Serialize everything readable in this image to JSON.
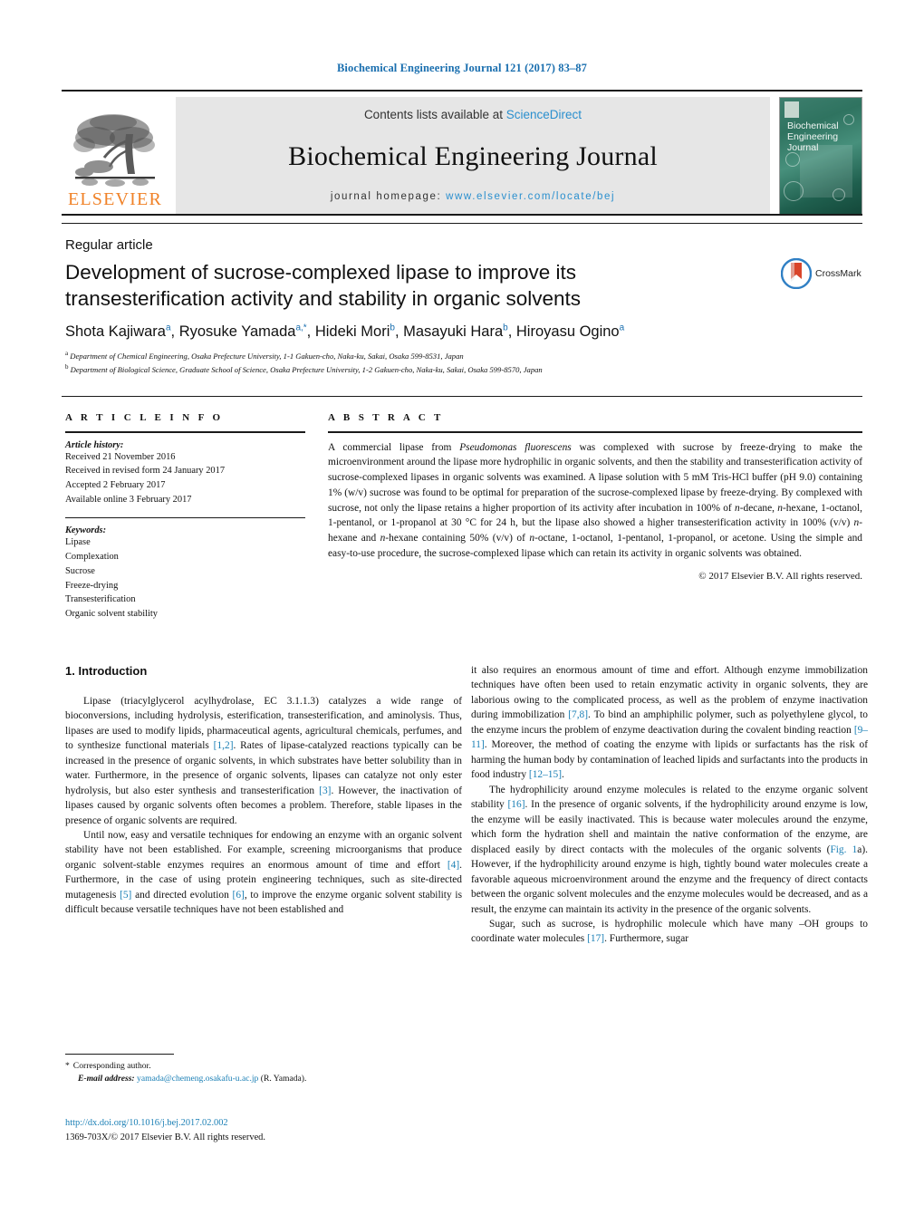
{
  "running_head": "Biochemical Engineering Journal 121 (2017) 83–87",
  "masthead": {
    "contents_prefix": "Contents lists available at ",
    "sciencedirect": "ScienceDirect",
    "journal_name": "Biochemical Engineering Journal",
    "homepage_label": "journal homepage:",
    "homepage_url": "www.elsevier.com/locate/bej",
    "publisher_wordmark": "ELSEVIER",
    "cover_title_line1": "Biochemical",
    "cover_title_line2": "Engineering",
    "cover_title_line3": "Journal",
    "accent_blue": "#2a8fce",
    "elsevier_orange": "#F08228"
  },
  "crossmark": {
    "label": "CrossMark"
  },
  "article": {
    "kicker": "Regular article",
    "title_line1": "Development of sucrose-complexed lipase to improve its",
    "title_line2": "transesterification activity and stability in organic solvents",
    "authors": [
      {
        "name": "Shota Kajiwara",
        "sup": "a",
        "sep": ", "
      },
      {
        "name": "Ryosuke Yamada",
        "sup": "a,",
        "star": "*",
        "sep": ", "
      },
      {
        "name": "Hideki Mori",
        "sup": "b",
        "sep": ", "
      },
      {
        "name": "Masayuki Hara",
        "sup": "b",
        "sep": ", "
      },
      {
        "name": "Hiroyasu Ogino",
        "sup": "a",
        "sep": ""
      }
    ],
    "affiliations": [
      {
        "marker": "a",
        "text": "Department of Chemical Engineering, Osaka Prefecture University, 1-1 Gakuen-cho, Naka-ku, Sakai, Osaka 599-8531, Japan"
      },
      {
        "marker": "b",
        "text": "Department of Biological Science, Graduate School of Science, Osaka Prefecture University, 1-2 Gakuen-cho, Naka-ku, Sakai, Osaka 599-8570, Japan"
      }
    ]
  },
  "article_info": {
    "heading": "A R T I C L E   I N F O",
    "history_label": "Article history:",
    "history": [
      "Received 21 November 2016",
      "Received in revised form 24 January 2017",
      "Accepted 2 February 2017",
      "Available online 3 February 2017"
    ],
    "keywords_label": "Keywords:",
    "keywords": [
      "Lipase",
      "Complexation",
      "Sucrose",
      "Freeze-drying",
      "Transesterification",
      "Organic solvent stability"
    ]
  },
  "abstract": {
    "heading": "A B S T R A C T",
    "text_parts": [
      {
        "t": "A commercial lipase from "
      },
      {
        "t": "Pseudomonas fluorescens",
        "i": true
      },
      {
        "t": " was complexed with sucrose by freeze-drying to make the microenvironment around the lipase more hydrophilic in organic solvents, and then the stability and transesterification activity of sucrose-complexed lipases in organic solvents was examined. A lipase solution with 5 mM Tris-HCl buffer (pH 9.0) containing 1% (w/v) sucrose was found to be optimal for preparation of the sucrose-complexed lipase by freeze-drying. By complexed with sucrose, not only the lipase retains a higher proportion of its activity after incubation in 100% of "
      },
      {
        "t": "n",
        "i": true
      },
      {
        "t": "-decane, "
      },
      {
        "t": "n",
        "i": true
      },
      {
        "t": "-hexane, 1-octanol, 1-pentanol, or 1-propanol at 30 °C for 24 h, but the lipase also showed a higher transesterification activity in 100% (v/v) "
      },
      {
        "t": "n",
        "i": true
      },
      {
        "t": "-hexane and "
      },
      {
        "t": "n",
        "i": true
      },
      {
        "t": "-hexane containing 50% (v/v) of "
      },
      {
        "t": "n",
        "i": true
      },
      {
        "t": "-octane, 1-octanol, 1-pentanol, 1-propanol, or acetone. Using the simple and easy-to-use procedure, the sucrose-complexed lipase which can retain its activity in organic solvents was obtained."
      }
    ],
    "copyright": "© 2017 Elsevier B.V. All rights reserved."
  },
  "body": {
    "section_title": "1.  Introduction",
    "left_paragraphs": [
      [
        {
          "t": "Lipase (triacylglycerol acylhydrolase, EC 3.1.1.3) catalyzes a wide range of bioconversions, including hydrolysis, esterification, transesterification, and aminolysis. Thus, lipases are used to modify lipids, pharmaceutical agents, agricultural chemicals, perfumes, and to synthesize functional materials "
        },
        {
          "t": "[1,2]",
          "ref": true
        },
        {
          "t": ". Rates of lipase-catalyzed reactions typically can be increased in the presence of organic solvents, in which substrates have better solubility than in water. Furthermore, in the presence of organic solvents, lipases can catalyze not only ester hydrolysis, but also ester synthesis and transesterification "
        },
        {
          "t": "[3]",
          "ref": true
        },
        {
          "t": ". However, the inactivation of lipases caused by organic solvents often becomes a problem. Therefore, stable lipases in the presence of organic solvents are required."
        }
      ],
      [
        {
          "t": "Until now, easy and versatile techniques for endowing an enzyme with an organic solvent stability have not been established. For example, screening microorganisms that produce organic solvent-stable enzymes requires an enormous amount of time and effort "
        },
        {
          "t": "[4]",
          "ref": true
        },
        {
          "t": ". Furthermore, in the case of using protein engineering techniques, such as site-directed mutagenesis "
        },
        {
          "t": "[5]",
          "ref": true
        },
        {
          "t": " and directed evolution "
        },
        {
          "t": "[6]",
          "ref": true
        },
        {
          "t": ", to improve the enzyme organic solvent stability is difficult because versatile techniques have not been established and"
        }
      ]
    ],
    "right_paragraphs": [
      [
        {
          "t": "it also requires an enormous amount of time and effort. Although enzyme immobilization techniques have often been used to retain enzymatic activity in organic solvents, they are laborious owing to the complicated process, as well as the problem of enzyme inactivation during immobilization "
        },
        {
          "t": "[7,8]",
          "ref": true
        },
        {
          "t": ". To bind an amphiphilic polymer, such as polyethylene glycol, to the enzyme incurs the problem of enzyme deactivation during the covalent binding reaction "
        },
        {
          "t": "[9–11]",
          "ref": true
        },
        {
          "t": ". Moreover, the method of coating the enzyme with lipids or surfactants has the risk of harming the human body by contamination of leached lipids and surfactants into the products in food industry "
        },
        {
          "t": "[12–15]",
          "ref": true
        },
        {
          "t": "."
        }
      ],
      [
        {
          "t": "The hydrophilicity around enzyme molecules is related to the enzyme organic solvent stability "
        },
        {
          "t": "[16]",
          "ref": true
        },
        {
          "t": ". In the presence of organic solvents, if the hydrophilicity around enzyme is low, the enzyme will be easily inactivated. This is because water molecules around the enzyme, which form the hydration shell and maintain the native conformation of the enzyme, are displaced easily by direct contacts with the molecules of the organic solvents ("
        },
        {
          "t": "Fig. 1",
          "ref": true
        },
        {
          "t": "a). However, if the hydrophilicity around enzyme is high, tightly bound water molecules create a favorable aqueous microenvironment around the enzyme and the frequency of direct contacts between the organic solvent molecules and the enzyme molecules would be decreased, and as a result, the enzyme can maintain its activity in the presence of the organic solvents."
        }
      ],
      [
        {
          "t": "Sugar, such as sucrose, is hydrophilic molecule which have many –OH groups to coordinate water molecules "
        },
        {
          "t": "[17]",
          "ref": true
        },
        {
          "t": ". Furthermore, sugar"
        }
      ]
    ]
  },
  "footnote": {
    "star": "*",
    "corresponding": "Corresponding author.",
    "email_label": "E-mail address:",
    "email": "yamada@chemeng.osakafu-u.ac.jp",
    "email_owner": "(R. Yamada)."
  },
  "footer": {
    "doi": "http://dx.doi.org/10.1016/j.bej.2017.02.002",
    "issn_line": "1369-703X/© 2017 Elsevier B.V. All rights reserved."
  }
}
